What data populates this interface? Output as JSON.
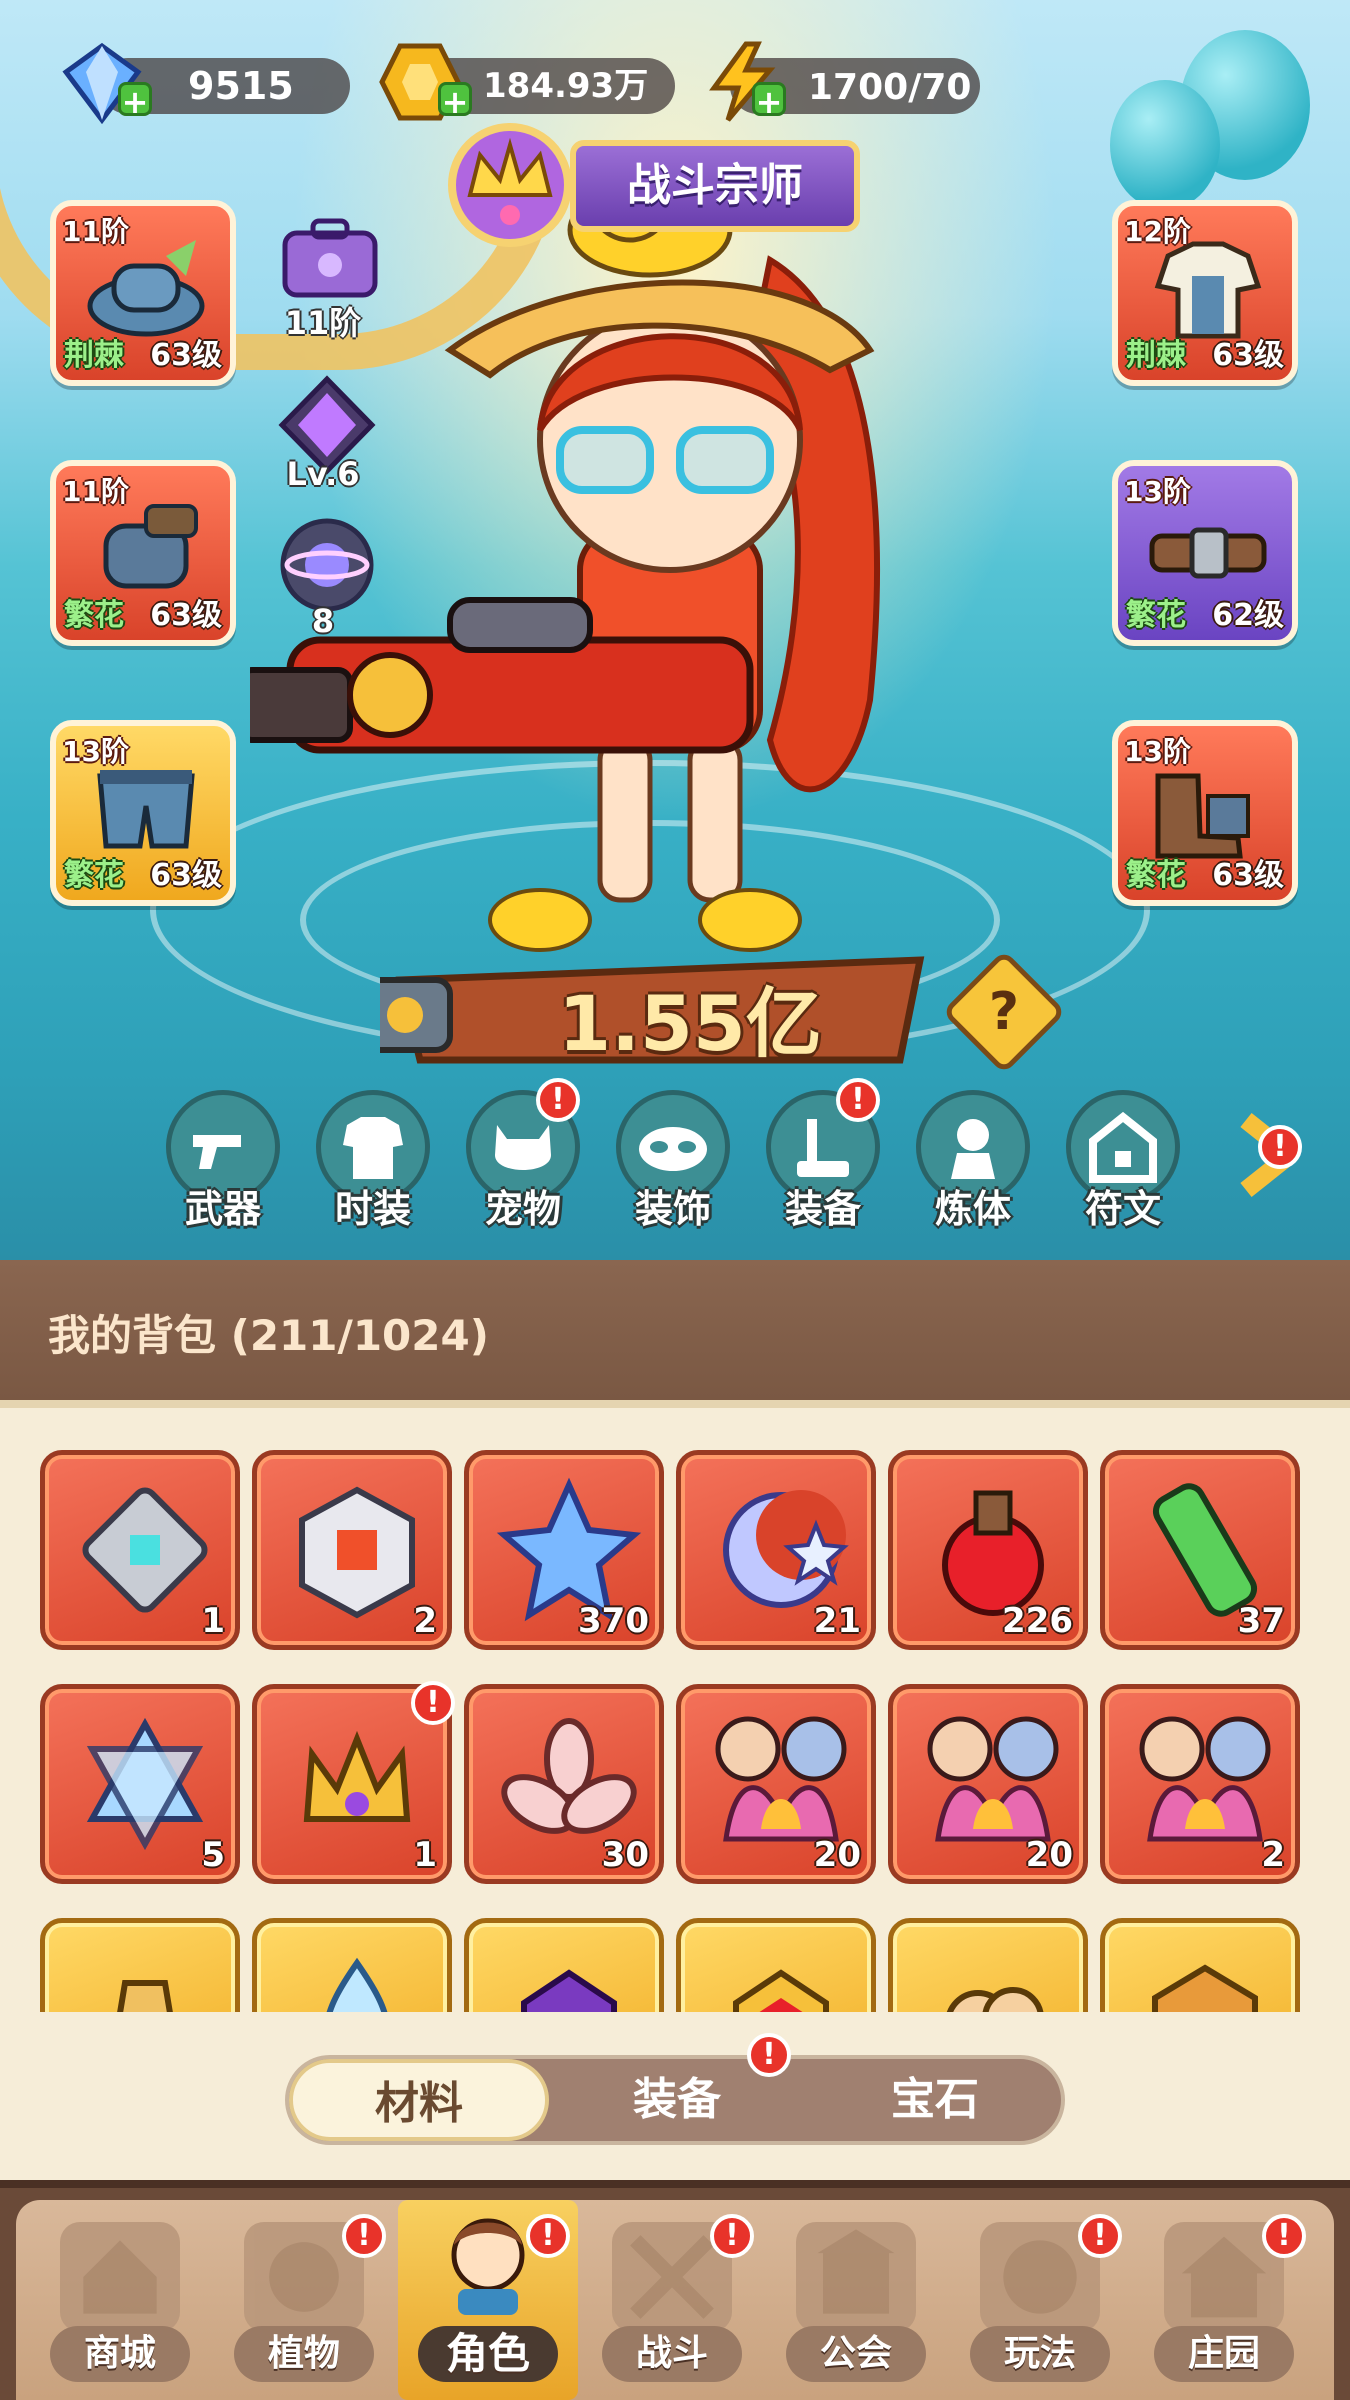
{
  "resources": {
    "gems": "9515",
    "gold": "184.93万",
    "energy": "1700/70"
  },
  "title_badge": "战斗宗师",
  "equipment_left": [
    {
      "tier": "11阶",
      "tag": "荆棘",
      "level": "63级",
      "icon": "hat-icon",
      "color": "red"
    },
    {
      "tier": "11阶",
      "tag": "繁花",
      "level": "63级",
      "icon": "glove-icon",
      "color": "red"
    },
    {
      "tier": "13阶",
      "tag": "繁花",
      "level": "63级",
      "icon": "shorts-icon",
      "color": "gold"
    }
  ],
  "equipment_right": [
    {
      "tier": "12阶",
      "tag": "荆棘",
      "level": "63级",
      "icon": "shirt-icon",
      "color": "red"
    },
    {
      "tier": "13阶",
      "tag": "繁花",
      "level": "62级",
      "icon": "belt-icon",
      "color": "purple"
    },
    {
      "tier": "13阶",
      "tag": "繁花",
      "level": "63级",
      "icon": "boots-icon",
      "color": "red"
    }
  ],
  "mini_stats": {
    "bag_tier": "11阶",
    "crystal_level": "Lv.6",
    "planet_count": "8"
  },
  "combat_power": "1.55亿",
  "help_label": "?",
  "functions": [
    {
      "label": "武器",
      "icon": "weapon-icon",
      "badge": false
    },
    {
      "label": "时装",
      "icon": "outfit-icon",
      "badge": false
    },
    {
      "label": "宠物",
      "icon": "pet-icon",
      "badge": true
    },
    {
      "label": "装饰",
      "icon": "mask-icon",
      "badge": false
    },
    {
      "label": "装备",
      "icon": "equipment-icon",
      "badge": true
    },
    {
      "label": "炼体",
      "icon": "body-refine-icon",
      "badge": false
    },
    {
      "label": "符文",
      "icon": "rune-icon",
      "badge": false
    }
  ],
  "bag": {
    "title": "我的背包 (211/1024)",
    "items": [
      {
        "count": "1",
        "icon": "frame-crystal-icon",
        "color": "red",
        "badge": false
      },
      {
        "count": "2",
        "icon": "cube-icon",
        "color": "red",
        "badge": false
      },
      {
        "count": "370",
        "icon": "blue-star-icon",
        "color": "red",
        "badge": false
      },
      {
        "count": "21",
        "icon": "moon-star-icon",
        "color": "red",
        "badge": false
      },
      {
        "count": "226",
        "icon": "potion-icon",
        "color": "red",
        "badge": false
      },
      {
        "count": "37",
        "icon": "green-tube-icon",
        "color": "red",
        "badge": false
      },
      {
        "count": "5",
        "icon": "hexagram-icon",
        "color": "red",
        "badge": false
      },
      {
        "count": "1",
        "icon": "crown-icon",
        "color": "red",
        "badge": true
      },
      {
        "count": "30",
        "icon": "knot-icon",
        "color": "red",
        "badge": false
      },
      {
        "count": "20",
        "icon": "flower-portrait-icon",
        "color": "red",
        "badge": false
      },
      {
        "count": "20",
        "icon": "flower-portrait-icon",
        "color": "red",
        "badge": false
      },
      {
        "count": "2",
        "icon": "flower-portrait-icon",
        "color": "red",
        "badge": false
      },
      {
        "count": "",
        "icon": "bottle-icon",
        "color": "gold",
        "badge": false
      },
      {
        "count": "",
        "icon": "droplet-icon",
        "color": "gold",
        "badge": false
      },
      {
        "count": "",
        "icon": "purple-gem-icon",
        "color": "gold",
        "badge": false
      },
      {
        "count": "",
        "icon": "red-gem-icon",
        "color": "gold",
        "badge": false
      },
      {
        "count": "",
        "icon": "swirl-icon",
        "color": "gold",
        "badge": false
      },
      {
        "count": "",
        "icon": "hex-gem-icon",
        "color": "gold",
        "badge": false
      }
    ]
  },
  "tabs": [
    {
      "label": "材料",
      "active": true,
      "badge": false
    },
    {
      "label": "装备",
      "active": false,
      "badge": true
    },
    {
      "label": "宝石",
      "active": false,
      "badge": false
    }
  ],
  "nav": [
    {
      "label": "商城",
      "icon": "shop-icon",
      "badge": false,
      "active": false
    },
    {
      "label": "植物",
      "icon": "plant-icon",
      "badge": true,
      "active": false
    },
    {
      "label": "角色",
      "icon": "character-icon",
      "badge": true,
      "active": true
    },
    {
      "label": "战斗",
      "icon": "battle-icon",
      "badge": true,
      "active": false
    },
    {
      "label": "公会",
      "icon": "guild-icon",
      "badge": false,
      "active": false
    },
    {
      "label": "玩法",
      "icon": "gameplay-icon",
      "badge": true,
      "active": false
    },
    {
      "label": "庄园",
      "icon": "manor-icon",
      "badge": true,
      "active": false
    }
  ],
  "badge_mark": "!",
  "colors": {
    "accent_red": "#d9432a",
    "gold": "#f0a81e",
    "purple": "#6a44c2",
    "badge_red": "#e8332a",
    "panel_bg": "#f6edd8"
  }
}
